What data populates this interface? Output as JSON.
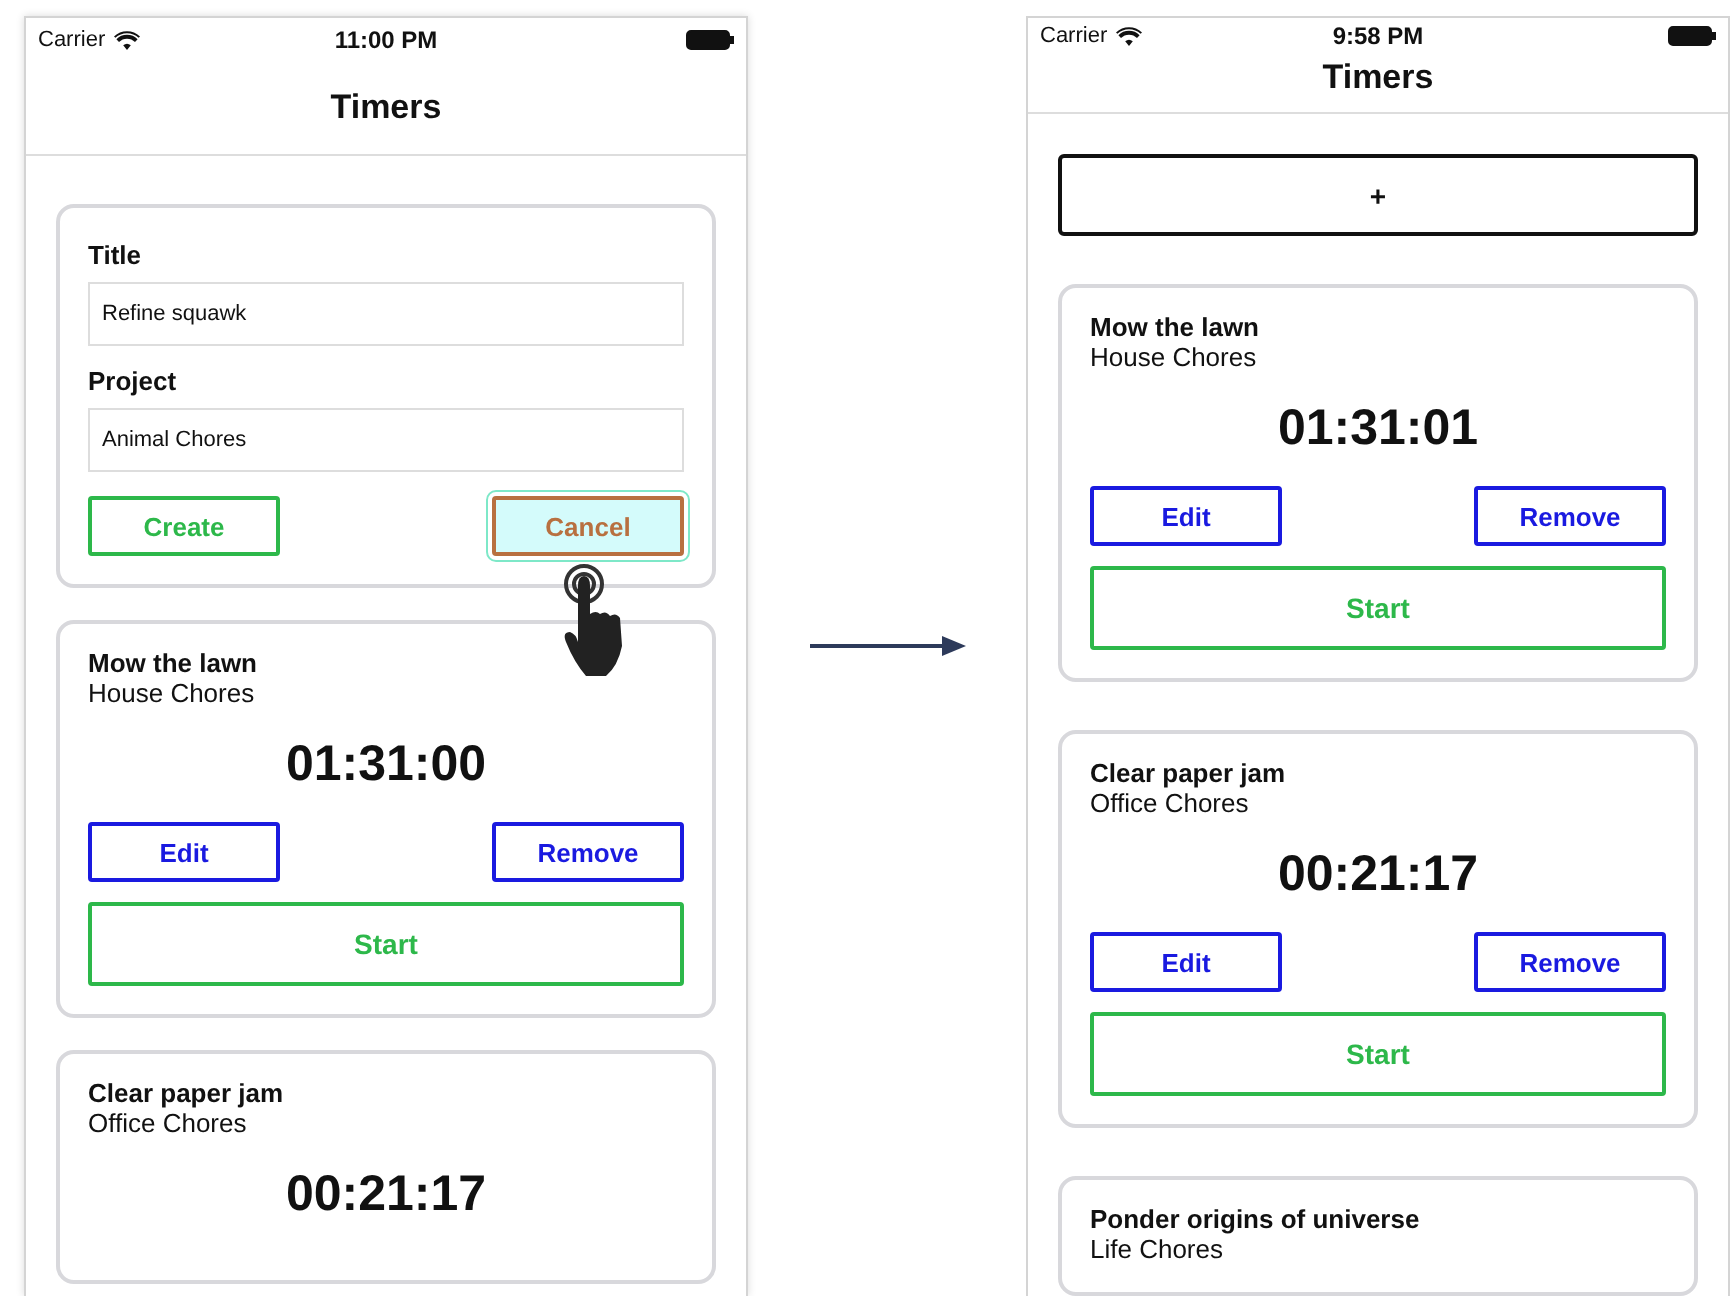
{
  "before": {
    "status_bar": {
      "carrier": "Carrier",
      "time": "11:00 PM"
    },
    "title": "Timers",
    "form": {
      "fields": [
        {
          "label": "Title",
          "value": "Refine squawk"
        },
        {
          "label": "Project",
          "value": "Animal Chores"
        }
      ],
      "buttons": [
        {
          "label": "Create",
          "kind": "create",
          "pressed": false
        },
        {
          "label": "Cancel",
          "kind": "cancel",
          "pressed": true
        }
      ]
    },
    "timers": [
      {
        "title": "Mow the lawn",
        "project": "House Chores",
        "elapsed": "01:31:00",
        "buttons": [
          {
            "label": "Edit",
            "kind": "edit"
          },
          {
            "label": "Remove",
            "kind": "remove"
          },
          {
            "label": "Start",
            "kind": "start"
          }
        ]
      },
      {
        "title": "Clear paper jam",
        "project": "Office Chores",
        "elapsed": "00:21:17"
      }
    ]
  },
  "after": {
    "status_bar": {
      "carrier": "Carrier",
      "time": "9:58 PM"
    },
    "title": "Timers",
    "add_button": {
      "label": "+"
    },
    "timers": [
      {
        "title": "Mow the lawn",
        "project": "House Chores",
        "elapsed": "01:31:01",
        "buttons": [
          {
            "label": "Edit",
            "kind": "edit"
          },
          {
            "label": "Remove",
            "kind": "remove"
          },
          {
            "label": "Start",
            "kind": "start"
          }
        ]
      },
      {
        "title": "Clear paper jam",
        "project": "Office Chores",
        "elapsed": "00:21:17",
        "buttons": [
          {
            "label": "Edit",
            "kind": "edit"
          },
          {
            "label": "Remove",
            "kind": "remove"
          },
          {
            "label": "Start",
            "kind": "start"
          }
        ]
      },
      {
        "title": "Ponder origins of universe",
        "project": "Life Chores"
      }
    ]
  }
}
